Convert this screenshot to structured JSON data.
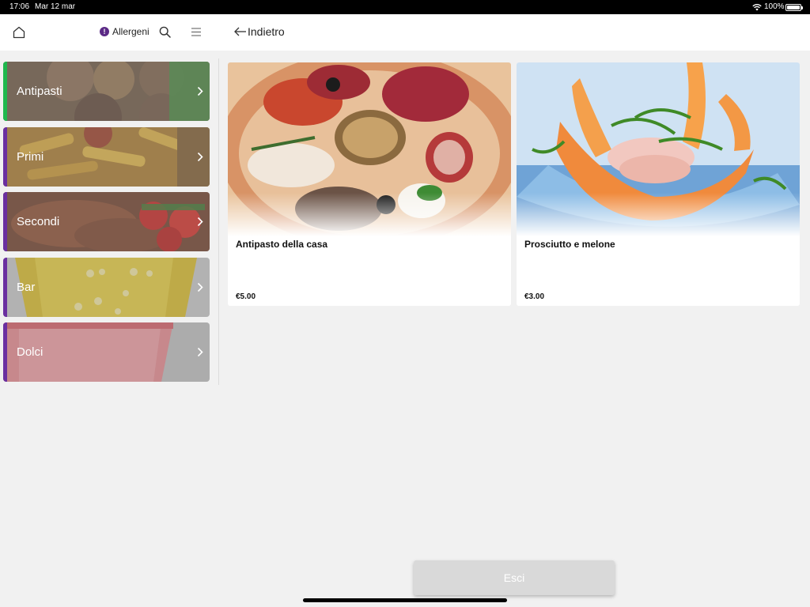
{
  "status_bar": {
    "time": "17:06",
    "date": "Mar 12 mar",
    "battery_percent": "100%",
    "battery_level": 1.0
  },
  "header": {
    "home_icon": "home-icon",
    "allergens_label": "Allergeni",
    "allergens_icon": "exclamation-circle-icon",
    "search_icon": "search-icon",
    "menu_icon": "hamburger-menu-icon",
    "back_label": "Indietro",
    "back_icon": "arrow-left-icon",
    "accent_color": "#5b2a86"
  },
  "categories": [
    {
      "label": "Antipasti",
      "stripe_color": "#1fb84d"
    },
    {
      "label": "Primi",
      "stripe_color": "#6a2fa0"
    },
    {
      "label": "Secondi",
      "stripe_color": "#6a2fa0"
    },
    {
      "label": "Bar",
      "stripe_color": "#6a2fa0"
    },
    {
      "label": "Dolci",
      "stripe_color": "#6a2fa0"
    }
  ],
  "products": [
    {
      "name": "Antipasto della casa",
      "price": "€5.00"
    },
    {
      "name": "Prosciutto e melone",
      "price": "€3.00"
    }
  ],
  "exit_button": {
    "label": "Esci"
  }
}
